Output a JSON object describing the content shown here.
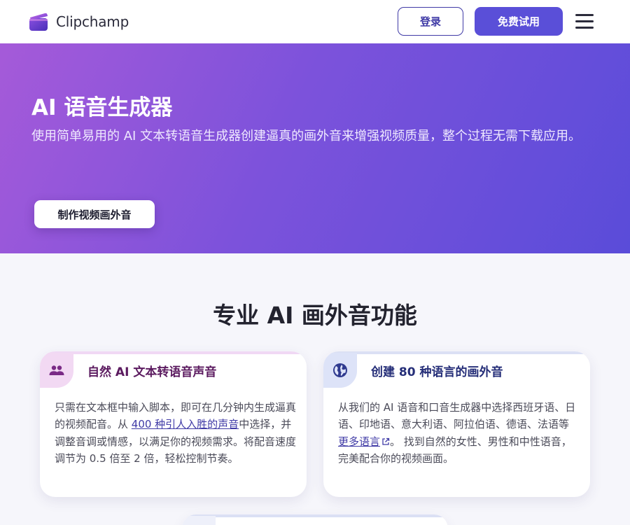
{
  "nav": {
    "logo_text": "Clipchamp",
    "login_label": "登录",
    "trial_label": "免费试用",
    "menu_icon": "hamburger-menu-icon"
  },
  "hero": {
    "title": "AI 语音生成器",
    "subtitle": "使用简单易用的 AI 文本转语音生成器创建逼真的画外音来增强视频质量，整个过程无需下载应用。",
    "cta_label": "制作视频画外音"
  },
  "features": {
    "title": "专业 AI 画外音功能",
    "cards": [
      {
        "icon": "people-icon",
        "title": "自然 AI 文本转语音声音",
        "body_pre": "只需在文本框中输入脚本，即可在几分钟内生成逼真的视频配音。从 ",
        "body_link": "400 种引人入胜的声音",
        "body_post": "中选择，并调整音调或情感，以满足你的视频需求。将配音速度调节为 0.5 倍至 2 倍，轻松控制节奏。"
      },
      {
        "icon": "globe-icon",
        "title": "创建 80 种语言的画外音",
        "body_pre": "从我们的 AI 语音和口音生成器中选择西班牙语、日语、印地语、意大利语、阿拉伯语、德语、法语等 ",
        "body_link": "更多语言",
        "body_post": "。 找到自然的女性、男性和中性语音，完美配合你的视频画面。"
      }
    ]
  },
  "colors": {
    "brand": "#5a4fd8",
    "hero_start": "#a55ad9",
    "hero_end": "#5a4cd9"
  }
}
